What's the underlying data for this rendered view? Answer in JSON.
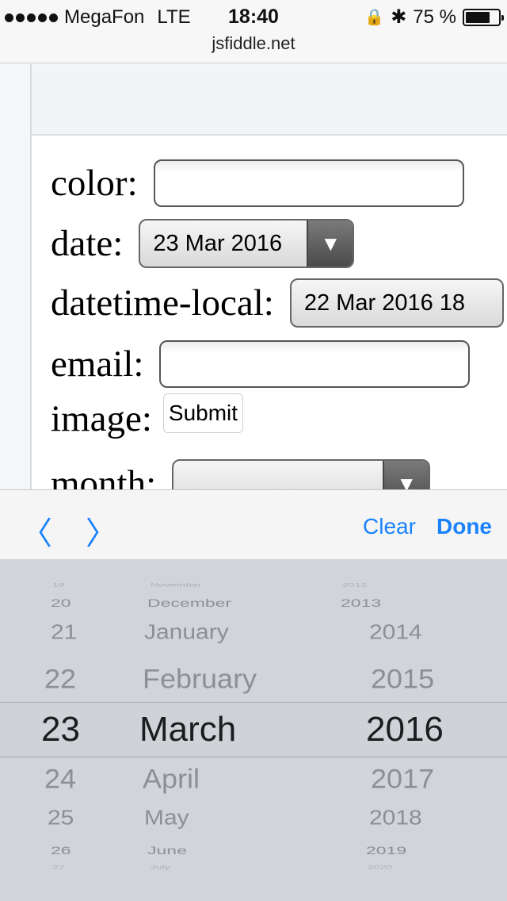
{
  "status_bar": {
    "carrier": "MegaFon",
    "network": "LTE",
    "time": "18:40",
    "lock_glyph": "🔒",
    "bluetooth_glyph": "✱",
    "battery_text": "75 %",
    "battery_level": 0.75
  },
  "browser": {
    "url": "jsfiddle.net"
  },
  "form": {
    "color_label": "color:",
    "date_label": "date:",
    "date_value": "23 Mar 2016",
    "datetime_label": "datetime-local:",
    "datetime_value": "22 Mar 2016 18",
    "email_label": "email:",
    "image_label": "image:",
    "image_button": "Submit",
    "month_label": "month:",
    "dropdown_glyph": "▼"
  },
  "accessory_bar": {
    "prev_glyph": "〈",
    "next_glyph": "〉",
    "clear_label": "Clear",
    "done_label": "Done"
  },
  "picker": {
    "days": [
      "19",
      "20",
      "21",
      "22",
      "23",
      "24",
      "25",
      "26",
      "27"
    ],
    "months": [
      "November",
      "December",
      "January",
      "February",
      "March",
      "April",
      "May",
      "June",
      "July"
    ],
    "years": [
      "2012",
      "2013",
      "2014",
      "2015",
      "2016",
      "2017",
      "2018",
      "2019",
      "2020"
    ],
    "selected": {
      "day": "23",
      "month": "March",
      "year": "2016"
    }
  }
}
